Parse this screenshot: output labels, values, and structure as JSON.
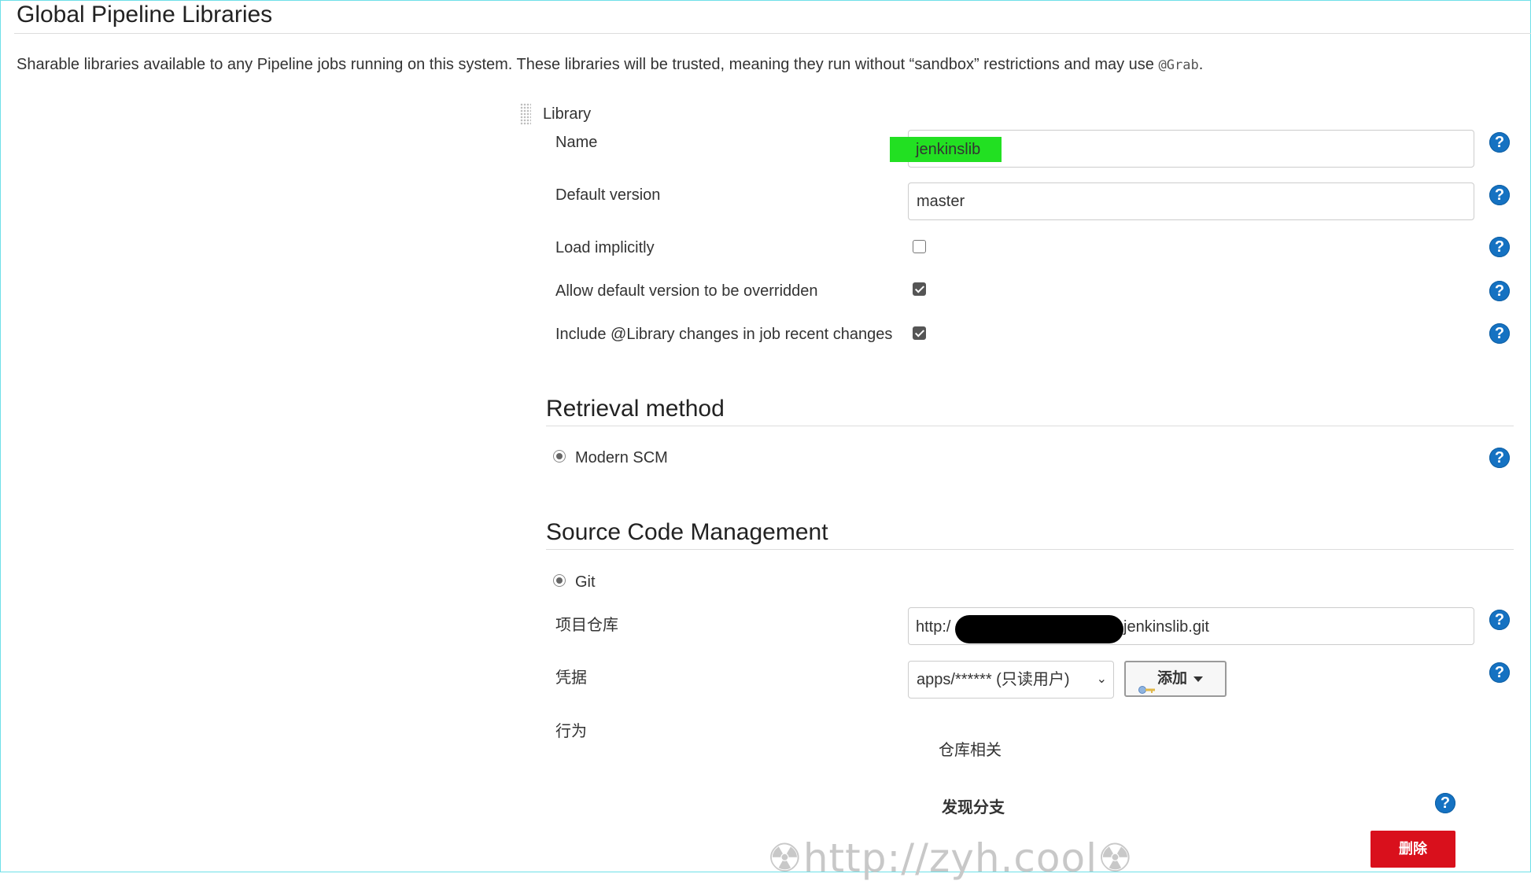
{
  "page": {
    "title": "Global Pipeline Libraries",
    "description": "Sharable libraries available to any Pipeline jobs running on this system. These libraries will be trusted, meaning they run without “sandbox” restrictions and may use",
    "description_code": "@Grab",
    "description_end": "."
  },
  "library": {
    "header": "Library",
    "name_label": "Name",
    "name_value": "jenkinslib",
    "default_version_label": "Default version",
    "default_version_value": "master",
    "load_implicitly_label": "Load implicitly",
    "load_implicitly_checked": false,
    "allow_override_label": "Allow default version to be overridden",
    "allow_override_checked": true,
    "include_changes_label": "Include @Library changes in job recent changes",
    "include_changes_checked": true
  },
  "retrieval": {
    "title": "Retrieval method",
    "option": "Modern SCM"
  },
  "scm": {
    "title": "Source Code Management",
    "option": "Git",
    "repo_label": "项目仓库",
    "repo_prefix": "http:/",
    "repo_suffix": "jenkinslib.git",
    "credentials_label": "凭据",
    "credentials_value": "apps/****** (只读用户)",
    "add_button_label": "添加",
    "behaviors_label": "行为",
    "behaviors_group": "仓库相关",
    "discover_branches": "发现分支",
    "delete_button_label": "删除"
  },
  "help_icon_text": "?",
  "watermark": "http://zyh.cool",
  "colors": {
    "help_blue": "#1572c2",
    "highlight_green": "#22e022",
    "delete_red": "#d9101c"
  }
}
